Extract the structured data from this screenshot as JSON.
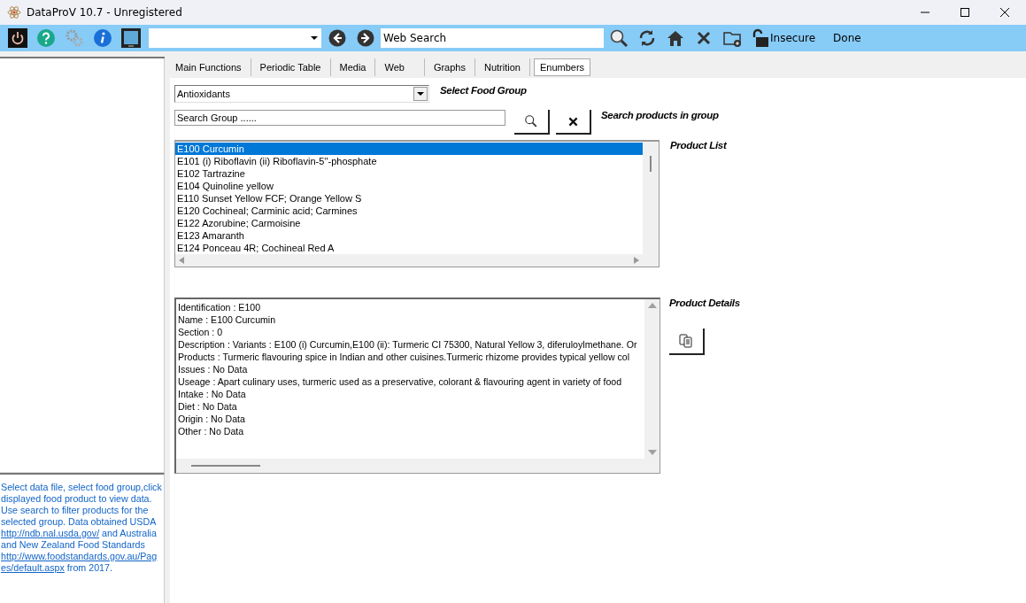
{
  "window": {
    "title": "DataProV 10.7 - Unregistered"
  },
  "toolbar": {
    "search": {
      "value": "Web Search"
    },
    "security": "Insecure",
    "status": "Done"
  },
  "tabs": [
    {
      "label": "Main Functions",
      "selected": false
    },
    {
      "label": "Periodic Table",
      "selected": false
    },
    {
      "label": "Media",
      "selected": false
    },
    {
      "label": "Web",
      "selected": false
    },
    {
      "label": "Graphs",
      "selected": false
    },
    {
      "label": "Nutrition",
      "selected": false
    },
    {
      "label": "Enumbers",
      "selected": true
    }
  ],
  "food_group": {
    "value": "Antioxidants",
    "label": "Select Food Group"
  },
  "search_group": {
    "placeholder": "Search Group ......",
    "label": "Search products in group"
  },
  "product_list": {
    "label": "Product List",
    "items": [
      {
        "text": "E100 Curcumin",
        "selected": true
      },
      {
        "text": "E101 (i) Riboflavin (ii) Riboflavin-5''-phosphate",
        "selected": false
      },
      {
        "text": "E102 Tartrazine",
        "selected": false
      },
      {
        "text": "E104 Quinoline yellow",
        "selected": false
      },
      {
        "text": "E110 Sunset Yellow FCF; Orange Yellow S",
        "selected": false
      },
      {
        "text": "E120 Cochineal; Carminic acid; Carmines",
        "selected": false
      },
      {
        "text": "E122 Azorubine; Carmoisine",
        "selected": false
      },
      {
        "text": "E123 Amaranth",
        "selected": false
      },
      {
        "text": "E124 Ponceau 4R; Cochineal Red A",
        "selected": false
      }
    ]
  },
  "product_details": {
    "label": "Product Details",
    "lines": [
      "Identification : E100",
      "Name : E100 Curcumin",
      "Section : 0",
      "Description : Variants : E100 (i) Curcumin,E100 (ii): Turmeric CI 75300, Natural Yellow 3, diferuloylmethane. Or",
      "Products : Turmeric flavouring spice in Indian and other cuisines.Turmeric rhizome provides typical yellow col",
      "Issues : No Data",
      "Useage : Apart culinary uses, turmeric used as a preservative, colorant & flavouring agent in variety of food",
      "Intake : No Data",
      "Diet : No Data",
      "Origin : No Data",
      "Other : No Data"
    ]
  },
  "help": {
    "parts": [
      {
        "kind": "text",
        "text": "Select data file, select food group,click displayed food product to view data. Use search to filter products for the selected group. Data obtained USDA "
      },
      {
        "kind": "link",
        "text": "http://ndb.nal.usda.gov/"
      },
      {
        "kind": "text",
        "text": " and Australia and New Zealand Food Standards "
      },
      {
        "kind": "link",
        "text": "http://www.foodstandards.gov.au/Pag"
      },
      {
        "kind": "link",
        "text": "es/default.aspx"
      },
      {
        "kind": "text",
        "text": " from 2017."
      }
    ]
  }
}
